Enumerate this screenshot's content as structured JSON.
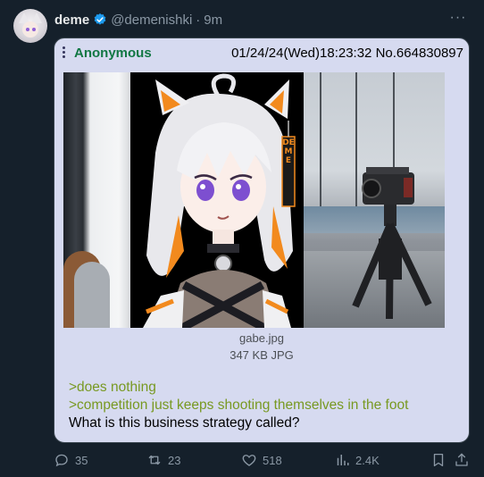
{
  "tweet": {
    "display_name": "deme",
    "handle": "@demenishki",
    "separator": "·",
    "time": "9m",
    "more_label": "···"
  },
  "post": {
    "poster_name": "Anonymous",
    "meta": "01/24/24(Wed)18:23:32 No.664830897",
    "file_name": "gabe.jpg",
    "file_size": "347 KB JPG",
    "greentext": [
      ">does nothing",
      ">competition just keeps shooting themselves in the foot"
    ],
    "body": "What is this business strategy called?",
    "image_text": "DEME"
  },
  "actions": {
    "replies": "35",
    "reposts": "23",
    "likes": "518",
    "views": "2.4K"
  },
  "colors": {
    "background": "#15202b",
    "card": "#d6daf0",
    "poster_name": "#117743",
    "greentext": "#789922",
    "verified": "#1d9bf0"
  },
  "icons": [
    "verified-badge-icon",
    "more-icon",
    "post-menu-icon",
    "reply-icon",
    "repost-icon",
    "like-icon",
    "views-icon",
    "bookmark-icon",
    "share-icon"
  ]
}
